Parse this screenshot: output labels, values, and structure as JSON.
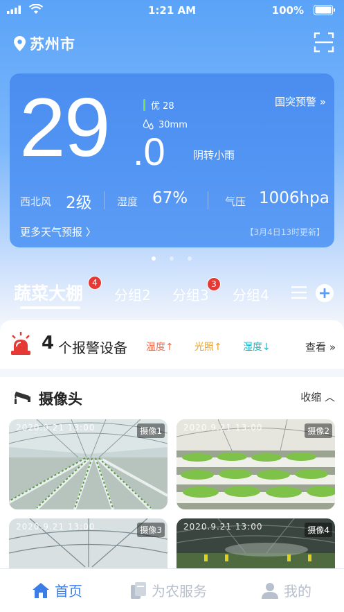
{
  "status_bar": {
    "time": "1:21 AM",
    "battery": "100%"
  },
  "header": {
    "city": "苏州市",
    "icons": [
      "location-pin-icon",
      "scan-icon"
    ]
  },
  "weather": {
    "temp_int": "29",
    "temp_dec": ".0",
    "aqi": "优 28",
    "aqi_color": "#7be04a",
    "rainfall": "30mm",
    "condition": "阴转小雨",
    "warning_link": "国突预警 »",
    "wind_label": "西北风",
    "wind_value": "2级",
    "humidity_label": "湿度",
    "humidity_value": "67%",
    "pressure_label": "气压",
    "pressure_value": "1006hpa",
    "more_forecast": "更多天气预报 〉",
    "update_time": "【3月4日13时更新】"
  },
  "carousel": {
    "count": 3,
    "active_index": 0
  },
  "groups": {
    "tabs": [
      {
        "label": "蔬菜大棚",
        "badge": "4",
        "active": true
      },
      {
        "label": "分组2",
        "badge": ""
      },
      {
        "label": "分组3",
        "badge": "3"
      },
      {
        "label": "分组4",
        "badge": ""
      }
    ],
    "icons": [
      "menu-icon",
      "add-icon"
    ]
  },
  "alarm": {
    "count": "4",
    "text": "个报警设备",
    "items": [
      {
        "label": "温度↑",
        "color": "#f26b4a"
      },
      {
        "label": "光照↑",
        "color": "#f0a020"
      },
      {
        "label": "湿度↓",
        "color": "#1fb5c6"
      }
    ],
    "view_link": "查看 »",
    "icon": "alarm-siren-icon"
  },
  "cameras": {
    "title": "摄像头",
    "collapse_label": "收缩 ︿",
    "items": [
      {
        "timestamp": "2020.9.21 13:00",
        "name": "摄像1"
      },
      {
        "timestamp": "2020.9.21 13:00",
        "name": "摄像2"
      },
      {
        "timestamp": "2020.9.21 13:00",
        "name": "摄像3"
      },
      {
        "timestamp": "2020.9.21 13:00",
        "name": "摄像4"
      }
    ]
  },
  "tabbar": {
    "items": [
      {
        "label": "首页",
        "icon": "home-icon",
        "active": true
      },
      {
        "label": "为农服务",
        "icon": "book-icon",
        "active": false
      },
      {
        "label": "我的",
        "icon": "user-icon",
        "active": false
      }
    ],
    "active_color": "#3a7de6",
    "inactive_color": "#b7c0cc"
  }
}
